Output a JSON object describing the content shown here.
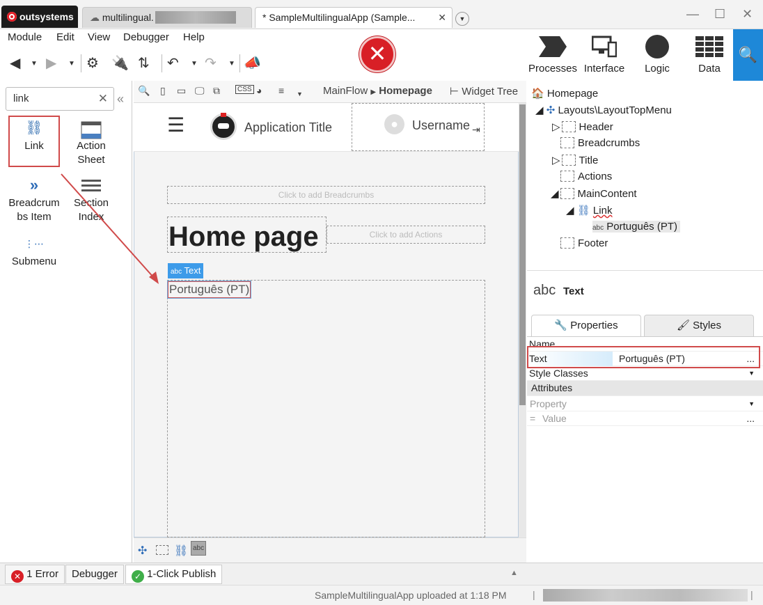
{
  "tabs": {
    "brand": "outsystems",
    "tab1_label": "multilingual.",
    "tab2_label": "* SampleMultilingualApp (Sample..."
  },
  "menu": [
    "Module",
    "Edit",
    "View",
    "Debugger",
    "Help"
  ],
  "big_tools": [
    "Processes",
    "Interface",
    "Logic",
    "Data"
  ],
  "toolbox": {
    "search_value": "link",
    "items": [
      {
        "label": "Link"
      },
      {
        "label": "Action\nSheet"
      },
      {
        "label": "Breadcrum\nbs Item"
      },
      {
        "label": "Section\nIndex"
      },
      {
        "label": "Submenu"
      }
    ]
  },
  "canvas_header": {
    "flow": "MainFlow",
    "screen": "Homepage",
    "widget_tree": "Widget Tree"
  },
  "canvas": {
    "app_title": "Application Title",
    "username": "Username",
    "breadcrumbs_placeholder": "Click to add Breadcrumbs",
    "page_title": "Home page",
    "actions_placeholder": "Click to add Actions",
    "text_badge": "Text",
    "link_text": "Português (PT)"
  },
  "tree": {
    "root": "Homepage",
    "layout": "Layouts\\LayoutTopMenu",
    "nodes": [
      "Header",
      "Breadcrumbs",
      "Title",
      "Actions",
      "MainContent"
    ],
    "link": "Link",
    "link_child": "Português (PT)",
    "footer": "Footer"
  },
  "properties": {
    "widget_type": "Text",
    "tab_properties": "Properties",
    "tab_styles": "Styles",
    "name_label": "Name",
    "text_label": "Text",
    "text_value": "Português (PT)",
    "style_classes_label": "Style Classes",
    "attributes_label": "Attributes",
    "property_placeholder": "Property",
    "value_placeholder": "Value"
  },
  "bottom": {
    "errors": "1 Error",
    "debugger": "Debugger",
    "publish": "1-Click Publish"
  },
  "status": {
    "message": "SampleMultilingualApp uploaded at 1:18 PM"
  },
  "colors": {
    "accent": "#1e88d8",
    "error": "#d81f26",
    "highlight": "#d04a4a"
  }
}
